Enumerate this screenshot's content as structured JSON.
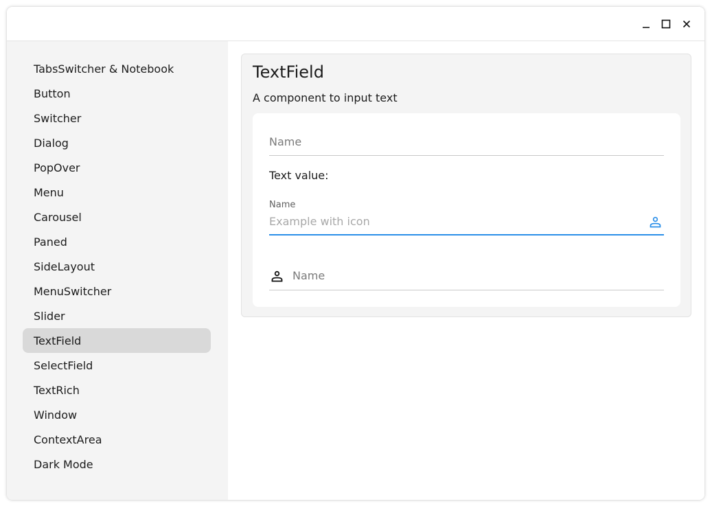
{
  "window": {
    "controls": {
      "minimize": "_",
      "maximize": "□",
      "close": "✕"
    }
  },
  "sidebar": {
    "items": [
      {
        "label": "TabsSwitcher & Notebook"
      },
      {
        "label": "Button"
      },
      {
        "label": "Switcher"
      },
      {
        "label": "Dialog"
      },
      {
        "label": "PopOver"
      },
      {
        "label": "Menu"
      },
      {
        "label": "Carousel"
      },
      {
        "label": "Paned"
      },
      {
        "label": "SideLayout"
      },
      {
        "label": "MenuSwitcher"
      },
      {
        "label": "Slider"
      },
      {
        "label": "TextField",
        "active": true
      },
      {
        "label": "SelectField"
      },
      {
        "label": "TextRich"
      },
      {
        "label": "Window"
      },
      {
        "label": "ContextArea"
      },
      {
        "label": "Dark Mode"
      }
    ]
  },
  "main": {
    "title": "TextField",
    "description": "A component to input text",
    "field1": {
      "placeholder": "Name",
      "value": ""
    },
    "text_value_label": "Text value:",
    "field2": {
      "label": "Name",
      "placeholder": "Example with icon",
      "icon": "person-icon",
      "focused": true
    },
    "field3": {
      "placeholder": "Name",
      "icon": "person-icon"
    }
  },
  "colors": {
    "accent": "#2a8ee8",
    "sidebar_bg": "#f4f4f4",
    "active_item_bg": "#d9d9d9"
  }
}
